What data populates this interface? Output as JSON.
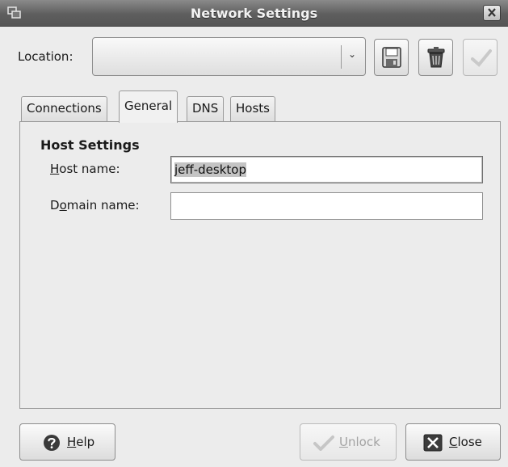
{
  "window": {
    "title": "Network Settings",
    "icons": {
      "menu": "window-menu-icon",
      "close": "close-x-icon"
    }
  },
  "location": {
    "label": "Location:",
    "selected_value": "",
    "toolbar_icons": [
      "save-floppy-icon",
      "delete-trash-icon",
      "apply-check-icon"
    ]
  },
  "tabs": [
    {
      "label": "Connections",
      "active": false
    },
    {
      "label": "General",
      "active": true
    },
    {
      "label": "DNS",
      "active": false
    },
    {
      "label": "Hosts",
      "active": false
    }
  ],
  "host_settings": {
    "title": "Host Settings",
    "host_name": {
      "label_mnemonic": "H",
      "label_rest": "ost name:",
      "value": "jeff-desktop"
    },
    "domain_name": {
      "label_pre": "D",
      "label_mnemonic": "o",
      "label_rest": "main name:",
      "value": ""
    }
  },
  "buttons": {
    "help": {
      "mnemonic": "H",
      "rest": "elp",
      "icon": "help-question-icon"
    },
    "unlock": {
      "mnemonic": "U",
      "rest": "nlock",
      "icon": "unlock-check-icon",
      "enabled": false
    },
    "close": {
      "mnemonic": "C",
      "rest": "lose",
      "icon": "close-x-icon"
    }
  },
  "colors": {
    "title_bar": "#5e5e5e",
    "panel": "#ececec",
    "selection": "#c4c4c4"
  }
}
